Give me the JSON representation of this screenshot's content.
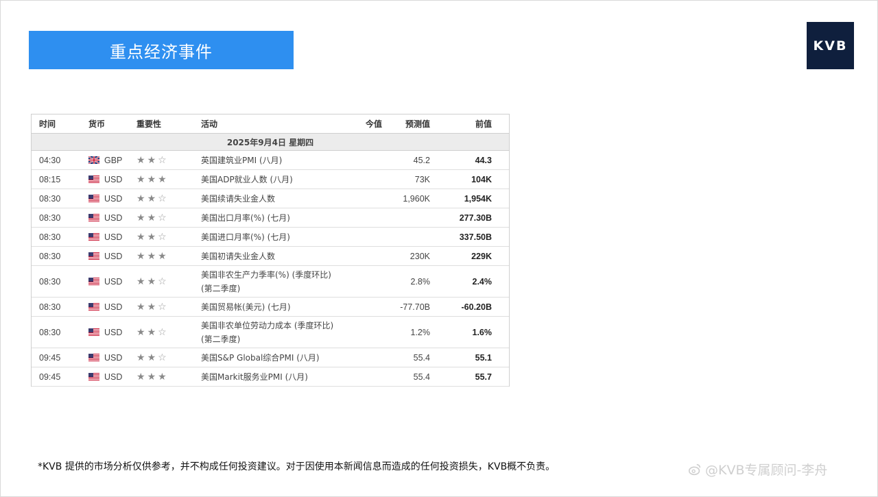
{
  "header": {
    "title": "重点经济事件"
  },
  "logo": {
    "text": "KVB"
  },
  "table": {
    "columns": {
      "time": "时间",
      "currency": "货币",
      "importance": "重要性",
      "event": "活动",
      "actual": "今值",
      "forecast": "预测值",
      "previous": "前值"
    },
    "date": "2025年9月4日  星期四",
    "rows": [
      {
        "time": "04:30",
        "flag": "uk-flag-icon",
        "currency": "GBP",
        "stars": 2,
        "event": "英国建筑业PMI (八月)",
        "actual": "",
        "forecast": "45.2",
        "previous": "44.3"
      },
      {
        "time": "08:15",
        "flag": "us-flag-icon",
        "currency": "USD",
        "stars": 3,
        "event": "美国ADP就业人数 (八月)",
        "actual": "",
        "forecast": "73K",
        "previous": "104K"
      },
      {
        "time": "08:30",
        "flag": "us-flag-icon",
        "currency": "USD",
        "stars": 2,
        "event": "美国续请失业金人数",
        "actual": "",
        "forecast": "1,960K",
        "previous": "1,954K"
      },
      {
        "time": "08:30",
        "flag": "us-flag-icon",
        "currency": "USD",
        "stars": 2,
        "event": "美国出口月率(%) (七月)",
        "actual": "",
        "forecast": "",
        "previous": "277.30B"
      },
      {
        "time": "08:30",
        "flag": "us-flag-icon",
        "currency": "USD",
        "stars": 2,
        "event": "美国进口月率(%) (七月)",
        "actual": "",
        "forecast": "",
        "previous": "337.50B"
      },
      {
        "time": "08:30",
        "flag": "us-flag-icon",
        "currency": "USD",
        "stars": 3,
        "event": "美国初请失业金人数",
        "actual": "",
        "forecast": "230K",
        "previous": "229K"
      },
      {
        "time": "08:30",
        "flag": "us-flag-icon",
        "currency": "USD",
        "stars": 2,
        "event": "美国非农生产力季率(%) (季度环比) (第二季度)",
        "actual": "",
        "forecast": "2.8%",
        "previous": "2.4%",
        "tall": true
      },
      {
        "time": "08:30",
        "flag": "us-flag-icon",
        "currency": "USD",
        "stars": 2,
        "event": "美国贸易帐(美元) (七月)",
        "actual": "",
        "forecast": "-77.70B",
        "previous": "-60.20B"
      },
      {
        "time": "08:30",
        "flag": "us-flag-icon",
        "currency": "USD",
        "stars": 2,
        "event": "美国非农单位劳动力成本 (季度环比) (第二季度)",
        "actual": "",
        "forecast": "1.2%",
        "previous": "1.6%",
        "tall": true
      },
      {
        "time": "09:45",
        "flag": "us-flag-icon",
        "currency": "USD",
        "stars": 2,
        "event": "美国S&P Global综合PMI (八月)",
        "actual": "",
        "forecast": "55.4",
        "previous": "55.1"
      },
      {
        "time": "09:45",
        "flag": "us-flag-icon",
        "currency": "USD",
        "stars": 3,
        "event": "美国Markit服务业PMI (八月)",
        "actual": "",
        "forecast": "55.4",
        "previous": "55.7"
      }
    ]
  },
  "footer": {
    "disclaimer": "*KVB 提供的市场分析仅供参考，并不构成任何投资建议。对于因使用本新闻信息而造成的任何投资损失，KVB概不负责。"
  },
  "watermark": {
    "text": "@KVB专属顾问-李舟"
  },
  "colors": {
    "banner": "#2e8ff0",
    "logo_bg": "#0f1f3d"
  }
}
